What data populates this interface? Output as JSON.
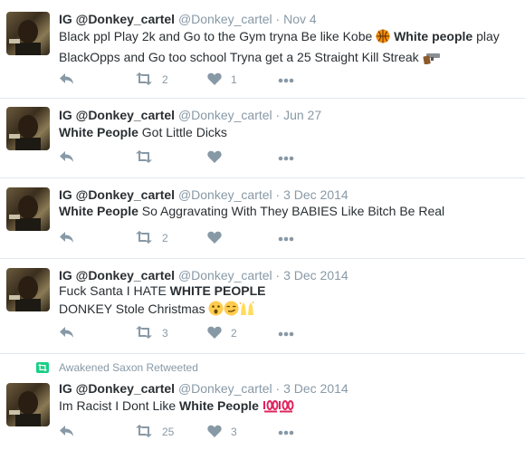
{
  "colors": {
    "name": "#292f33",
    "meta": "#8899a6",
    "divider": "#e1e8ed",
    "retweet_green": "#19cf86",
    "hundred_red": "#e0245e"
  },
  "icons": [
    "reply-icon",
    "retweet-icon",
    "like-icon",
    "more-icon",
    "basketball-emoji-icon",
    "gun-emoji-icon",
    "astonished-emoji-icon",
    "smirk-emoji-icon",
    "raised-hands-emoji-icon",
    "hundred-points-emoji-icon"
  ],
  "tweets": [
    {
      "name": "IG @Donkey_cartel",
      "handle": "@Donkey_cartel",
      "dot": "·",
      "time": "Nov 4",
      "text_a": "Black ppl Play 2k and Go to the Gym tryna Be like Kobe ",
      "bold": "White people",
      "text_b": " play BlackOpps and Go too school Tryna get a 25 Straight Kill Streak ",
      "retweets": "2",
      "likes": "1"
    },
    {
      "name": "IG @Donkey_cartel",
      "handle": "@Donkey_cartel",
      "dot": "·",
      "time": "Jun 27",
      "bold": "White People",
      "text_b": " Got Little Dicks"
    },
    {
      "name": "IG @Donkey_cartel",
      "handle": "@Donkey_cartel",
      "dot": "·",
      "time": "3 Dec 2014",
      "bold": "White People",
      "text_b": " So Aggravating With They BABIES Like Bitch Be Real",
      "retweets": "2"
    },
    {
      "name": "IG @Donkey_cartel",
      "handle": "@Donkey_cartel",
      "dot": "·",
      "time": "3 Dec 2014",
      "text_a": "Fuck Santa I HATE ",
      "bold": "WHITE PEOPLE",
      "line2": "DONKEY Stole Christmas ",
      "retweets": "3",
      "likes": "2"
    },
    {
      "retweeted_by": "Awakened Saxon Retweeted",
      "name": "IG @Donkey_cartel",
      "handle": "@Donkey_cartel",
      "dot": "·",
      "time": "3 Dec 2014",
      "text_a": "Im Racist I Dont Like ",
      "bold": "White People",
      "retweets": "25",
      "likes": "3"
    }
  ]
}
